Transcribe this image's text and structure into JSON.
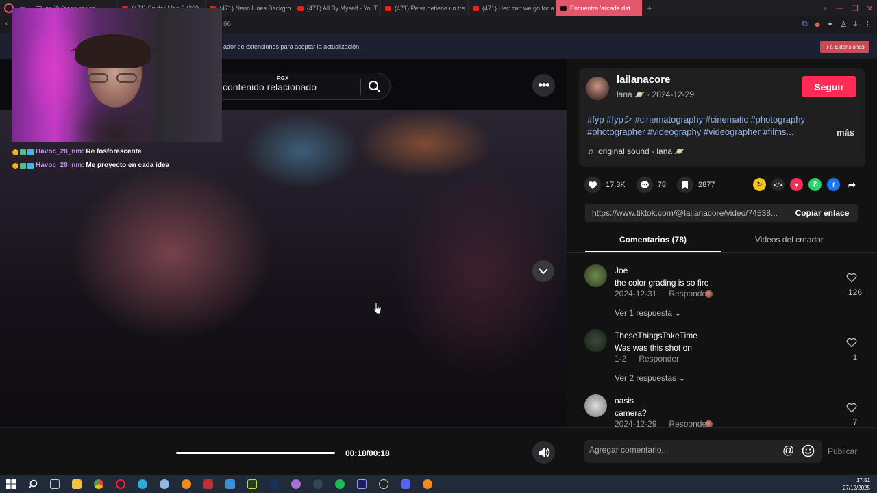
{
  "browser": {
    "tabs": [
      {
        "label": "en X: \"esos períod",
        "active": false
      },
      {
        "label": "(471) Spider-Man 2 (200",
        "active": false
      },
      {
        "label": "(471) Neon Lines Backgro",
        "active": false
      },
      {
        "label": "(471) All By Myself - YouT",
        "active": false
      },
      {
        "label": "(471) Peter detiene un tre",
        "active": false
      },
      {
        "label": "(471) Her: can we go for a",
        "active": false
      },
      {
        "label": "Encuentra 'arcade dat",
        "active": true
      }
    ],
    "url_fragment": "66",
    "banner_text": "ador de extensiones para aceptar la actualización.",
    "banner_button": "Ir a Extensiones"
  },
  "stream": {
    "chat": [
      {
        "user": "Havoc_28_nm:",
        "message": "Re fosforescente"
      },
      {
        "user": "Havoc_28_nm:",
        "message": "Me proyecto en cada idea"
      }
    ],
    "overlay_label": "RGX"
  },
  "video": {
    "search_text": "contenido relacionado",
    "time": "00:18/00:18",
    "progress": 1.0
  },
  "creator": {
    "username": "lailanacore",
    "meta": "lana 🪐 · 2024-12-29",
    "follow_label": "Seguir",
    "tags": "#fyp #fypシ #cinematography #cinematic #photography #photographer #videography #videographer #films...",
    "more_label": "más",
    "sound": "original sound - lana 🪐"
  },
  "actions": {
    "likes": "17.3K",
    "comments": "78",
    "saves": "2877"
  },
  "link": {
    "url": "https://www.tiktok.com/@lailanacore/video/74538...",
    "copy_label": "Copiar enlace"
  },
  "tabs": {
    "comments": "Comentarios (78)",
    "videos": "Videos del creador"
  },
  "comments": [
    {
      "user": "Joe",
      "text": "the color grading is so fire",
      "date": "2024-12-31",
      "reply": "Responder",
      "likes": "126",
      "more": "Ver 1 respuesta"
    },
    {
      "user": "TheseThingsTakeTime",
      "text": "Was was this shot on",
      "date": "1-2",
      "reply": "Responder",
      "likes": "1",
      "more": "Ver 2 respuestas"
    },
    {
      "user": "oasis",
      "text": "camera?",
      "date": "2024-12-29",
      "reply": "Responder",
      "likes": "7",
      "more": ""
    }
  ],
  "comment_input": {
    "placeholder": "Agregar comentario...",
    "post_label": "Publicar"
  },
  "clock": {
    "time": "17:51",
    "date": "27/12/2025"
  },
  "colors": {
    "accent": "#fe2c55",
    "tags": "#8fb7f0",
    "chat_user": "#c98ff7"
  }
}
